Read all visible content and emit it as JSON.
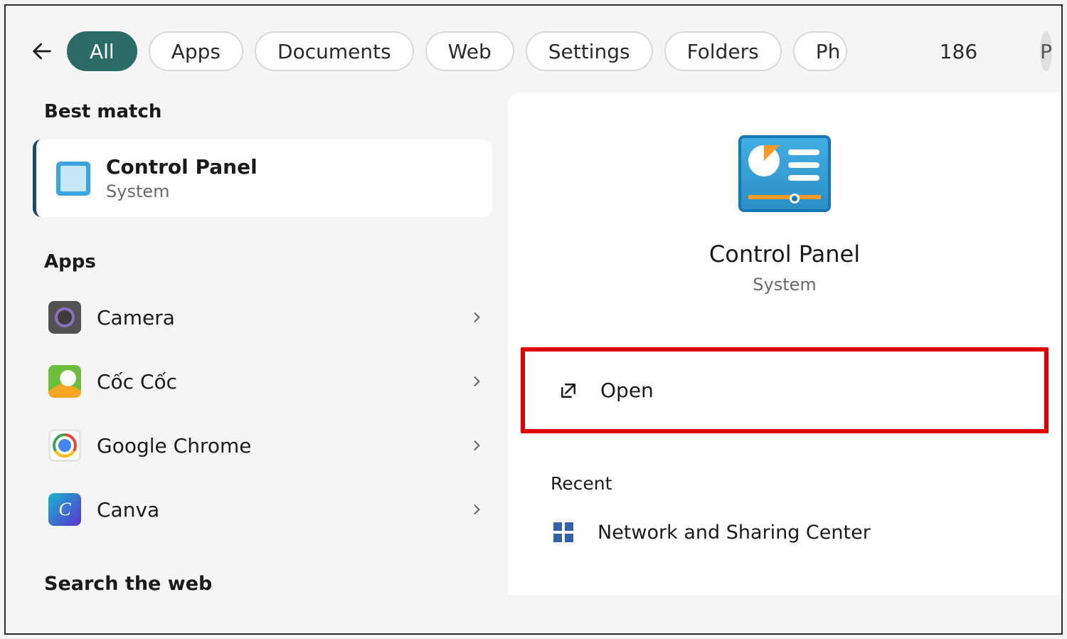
{
  "header": {
    "filters": [
      {
        "label": "All",
        "active": true
      },
      {
        "label": "Apps",
        "active": false
      },
      {
        "label": "Documents",
        "active": false
      },
      {
        "label": "Web",
        "active": false
      },
      {
        "label": "Settings",
        "active": false
      },
      {
        "label": "Folders",
        "active": false
      },
      {
        "label": "Ph",
        "active": false,
        "truncated": true
      }
    ],
    "points": "186",
    "avatar_letter": "P"
  },
  "left": {
    "best_match_title": "Best match",
    "best_match": {
      "title": "Control Panel",
      "subtitle": "System"
    },
    "apps_title": "Apps",
    "apps": [
      {
        "name": "Camera",
        "icon": "camera"
      },
      {
        "name": "Cốc Cốc",
        "icon": "coc"
      },
      {
        "name": "Google Chrome",
        "icon": "chrome"
      },
      {
        "name": "Canva",
        "icon": "canva"
      }
    ],
    "search_web_title": "Search the web"
  },
  "right": {
    "title": "Control Panel",
    "subtitle": "System",
    "open_label": "Open",
    "recent_title": "Recent",
    "recent_items": [
      {
        "label": "Network and Sharing Center"
      }
    ]
  }
}
